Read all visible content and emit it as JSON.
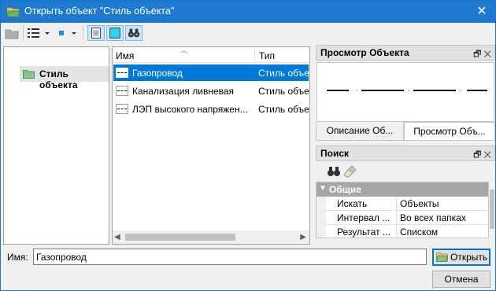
{
  "window": {
    "title": "Открыть объект \"Стиль объекта\"",
    "close_glyph": "✕"
  },
  "toolbar": {
    "icons": [
      "folder-up-icon",
      "list-view-icon",
      "dropdown-arrow-icon",
      "small-square-icon",
      "dropdown-arrow-icon",
      "description-view-icon",
      "preview-view-icon",
      "search-binoculars-icon"
    ]
  },
  "tree": {
    "items": [
      {
        "label": "Стиль объекта",
        "icon": "folder-icon"
      }
    ]
  },
  "list": {
    "columns": {
      "name": "Имя",
      "type": "Тип"
    },
    "rows": [
      {
        "name": "Газопровод",
        "type": "Стиль объекта",
        "selected": true
      },
      {
        "name": "Канализация ливневая",
        "type": "Стиль объекта",
        "selected": false
      },
      {
        "name": "ЛЭП высокого напряжен...",
        "type": "Стиль объекта",
        "selected": false
      }
    ]
  },
  "preview_panel": {
    "title": "Просмотр Объекта",
    "pin_glyph": "🗗",
    "close_glyph": "✕",
    "tabs": [
      "Описание Об...",
      "Просмотр Объ..."
    ]
  },
  "search_panel": {
    "title": "Поиск",
    "pin_glyph": "🗗",
    "close_glyph": "✕",
    "group": "Общие",
    "props": [
      {
        "key": "Искать",
        "value": "Объекты"
      },
      {
        "key": "Интервал ...",
        "value": "Во всех папках"
      },
      {
        "key": "Результат ...",
        "value": "Списком"
      }
    ]
  },
  "footer": {
    "name_label": "Имя:",
    "name_value": "Газопровод",
    "open_label": "Открыть",
    "cancel_label": "Отмена"
  },
  "colors": {
    "titlebar": "#1e7ad0",
    "selection": "#0078d7"
  }
}
